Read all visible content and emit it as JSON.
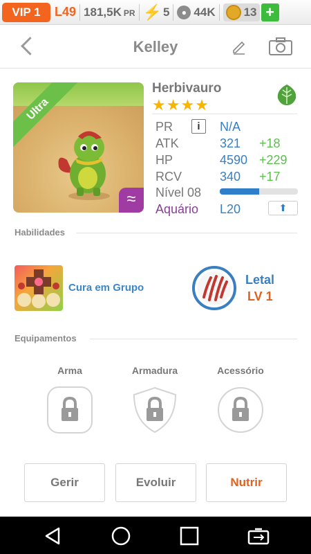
{
  "topbar": {
    "vip": "VIP 1",
    "level": "L49",
    "coins": "181,5K",
    "coins_unit": "PR",
    "energy": "5",
    "food": "44K",
    "gems": "13",
    "add": "+"
  },
  "header": {
    "title": "Kelley"
  },
  "monster": {
    "rarity": "Ultra",
    "species": "Herbivauro",
    "stars": "★★★★",
    "element_icon": "leaf-icon",
    "rows": [
      {
        "label": "PR",
        "value": "N/A",
        "bonus": ""
      },
      {
        "label": "ATK",
        "value": "321",
        "bonus": "+18"
      },
      {
        "label": "HP",
        "value": "4590",
        "bonus": "+229"
      },
      {
        "label": "RCV",
        "value": "340",
        "bonus": "+17"
      }
    ],
    "level_label": "Nível 08",
    "level_progress": 0.5,
    "habitat_label": "Aquário",
    "habitat_value": "L20"
  },
  "sections": {
    "skills": "Habilidades",
    "equipment": "Equipamentos"
  },
  "skills": {
    "group_heal": "Cura em Grupo",
    "lethal": "Letal",
    "lethal_level": "LV 1"
  },
  "equipment": {
    "weapon": "Arma",
    "armor": "Armadura",
    "accessory": "Acessório"
  },
  "actions": {
    "manage": "Gerir",
    "evolve": "Evoluir",
    "feed": "Nutrir"
  },
  "colors": {
    "accent_orange": "#f3641f",
    "blue": "#3a7fc1",
    "green": "#5cbf4c",
    "purple": "#8a3d99"
  }
}
